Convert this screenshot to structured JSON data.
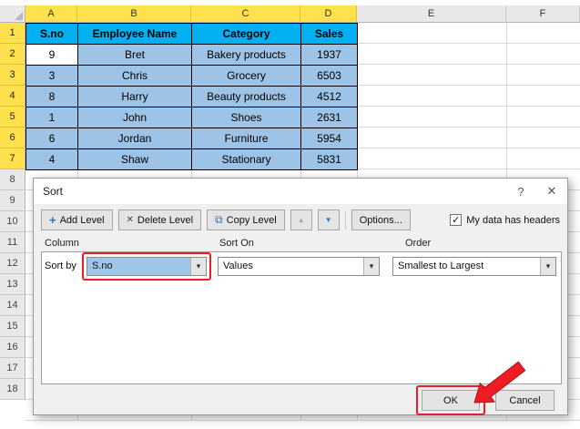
{
  "sheet": {
    "col_headers": [
      "A",
      "B",
      "C",
      "D",
      "E",
      "F"
    ],
    "row_numbers": [
      "1",
      "2",
      "3",
      "4",
      "5",
      "6",
      "7",
      "8",
      "9",
      "10",
      "11",
      "12",
      "13",
      "14",
      "15",
      "16",
      "17",
      "18"
    ],
    "table": {
      "headers": [
        "S.no",
        "Employee Name",
        "Category",
        "Sales"
      ],
      "rows": [
        [
          "9",
          "Bret",
          "Bakery products",
          "1937"
        ],
        [
          "3",
          "Chris",
          "Grocery",
          "6503"
        ],
        [
          "8",
          "Harry",
          "Beauty products",
          "4512"
        ],
        [
          "1",
          "John",
          "Shoes",
          "2631"
        ],
        [
          "6",
          "Jordan",
          "Furniture",
          "5954"
        ],
        [
          "4",
          "Shaw",
          "Stationary",
          "5831"
        ]
      ]
    }
  },
  "dialog": {
    "title": "Sort",
    "help_label": "?",
    "close_label": "✕",
    "toolbar": {
      "add_level": "Add Level",
      "delete_level": "Delete Level",
      "copy_level": "Copy Level",
      "options": "Options...",
      "headers_checkbox": "My data has headers"
    },
    "section_labels": {
      "column": "Column",
      "sort_on": "Sort On",
      "order": "Order"
    },
    "criteria": {
      "sort_by_label": "Sort by",
      "column_value": "S.no",
      "sort_on_value": "Values",
      "order_value": "Smallest to Largest"
    },
    "footer": {
      "ok": "OK",
      "cancel": "Cancel"
    }
  },
  "colors": {
    "selection_gold": "#FFE14D",
    "table_header_cyan": "#00B0F0",
    "cell_blue": "#9DC3E6",
    "dropdown_highlight_blue": "#9FC6E8",
    "annotation_red": "#EE1C25"
  }
}
